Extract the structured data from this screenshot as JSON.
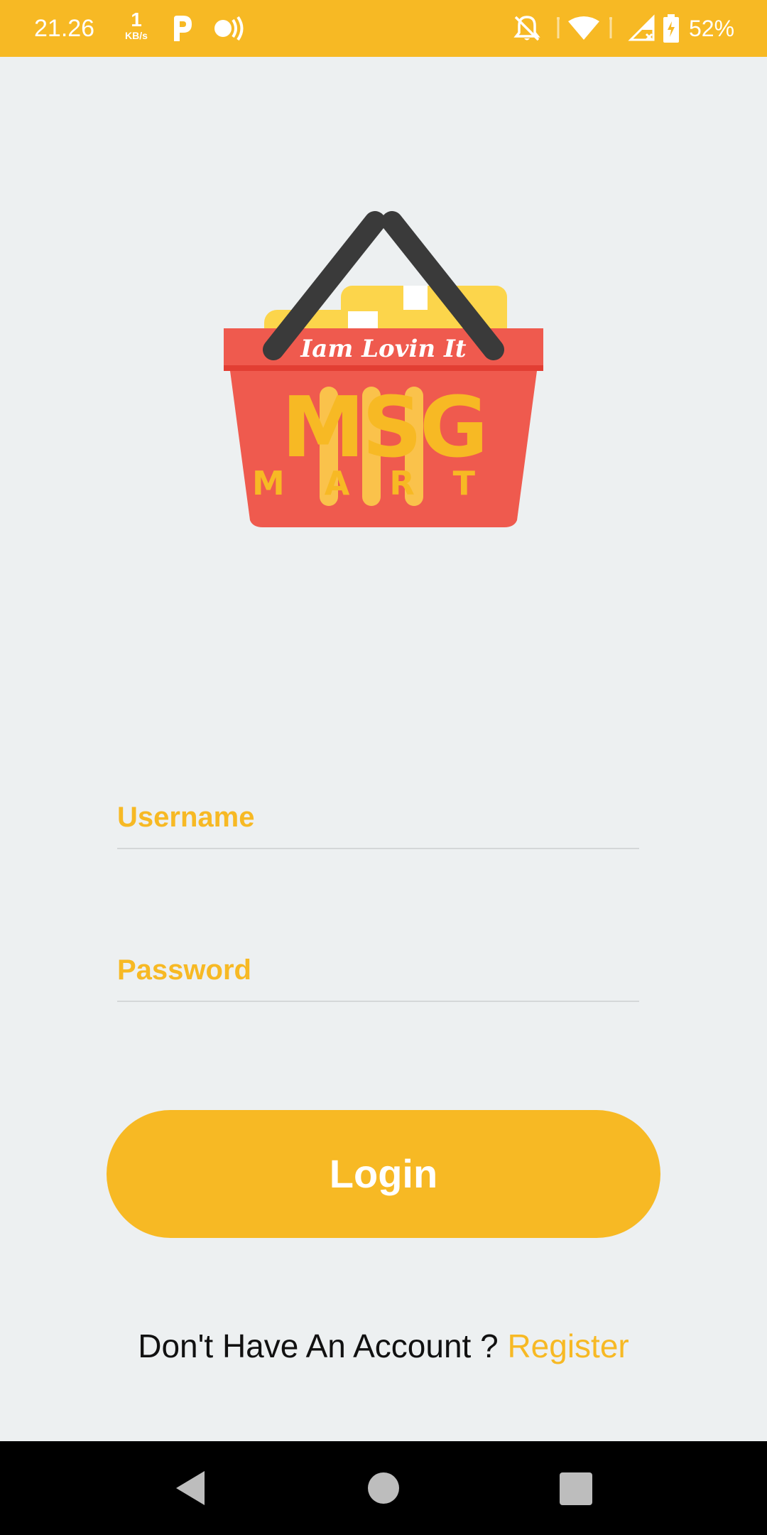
{
  "status_bar": {
    "time": "21.26",
    "net_speed": "1",
    "net_unit": "KB/s",
    "battery": "52%",
    "icons": [
      "parking-app-icon",
      "nfc-icon",
      "mute-icon",
      "wifi-icon",
      "signal-icon",
      "battery-icon"
    ]
  },
  "logo": {
    "tagline": "Iam Lovin It",
    "brand": "MSG",
    "sub": "MART"
  },
  "login_form": {
    "username_label": "Username",
    "password_label": "Password",
    "login_label": "Login"
  },
  "register": {
    "prompt": "Don't Have An Account ? ",
    "link": "Register"
  },
  "nav_bar": {
    "icons": [
      "back-icon",
      "home-icon",
      "recents-icon"
    ]
  },
  "colors": {
    "accent": "#F7B924",
    "background": "#EDF0F1",
    "basket": "#EF5A4E",
    "handle": "#3A3A3A"
  }
}
